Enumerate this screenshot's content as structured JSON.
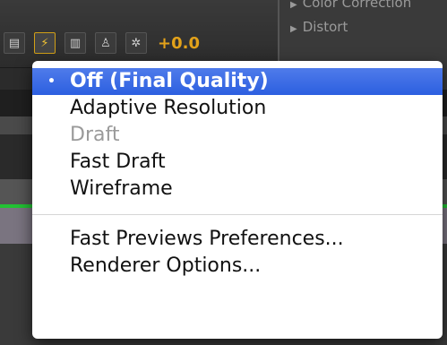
{
  "toolbar": {
    "exposure_value": "+0.0",
    "icons": [
      "grid-icon",
      "fast-previews-icon",
      "view-icon",
      "hierarchy-icon",
      "exposure-icon"
    ]
  },
  "panel": {
    "items": [
      "Color Correction",
      "Distort"
    ]
  },
  "menu": {
    "items": [
      {
        "label": "Off (Final Quality)",
        "state": "selected"
      },
      {
        "label": "Adaptive Resolution",
        "state": "normal"
      },
      {
        "label": "Draft",
        "state": "disabled"
      },
      {
        "label": "Fast Draft",
        "state": "normal"
      },
      {
        "label": "Wireframe",
        "state": "normal"
      }
    ],
    "footer_items": [
      {
        "label": "Fast Previews Preferences..."
      },
      {
        "label": "Renderer Options..."
      }
    ],
    "selected_marker": "•"
  },
  "colors": {
    "highlight": "#2c5fe0",
    "accent": "#e3a21a"
  }
}
